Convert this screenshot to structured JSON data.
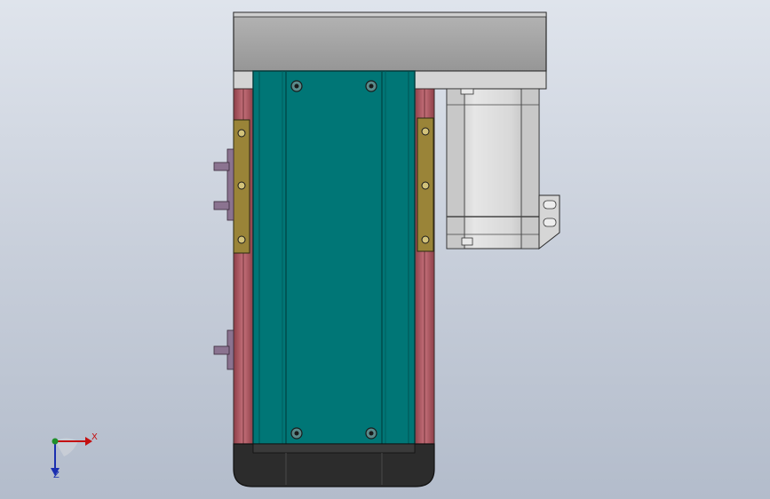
{
  "viewport": {
    "background_top": "#dfe4ec",
    "background_bottom": "#b3bccb"
  },
  "colors": {
    "carriage": "#007676",
    "carriage_edge": "#004c4c",
    "side_rail": "#b9606a",
    "guide_block": "#9a8438",
    "top_housing": "#a3a3a3",
    "motor_body": "#d8d8d8",
    "end_cap": "#2c2c2c",
    "bolt": "#2a2a2a"
  },
  "triad": {
    "x_label": "X",
    "z_label": "Z",
    "x_color": "#c41010",
    "y_color": "#1f8f2a",
    "z_color": "#1a2fb0"
  }
}
